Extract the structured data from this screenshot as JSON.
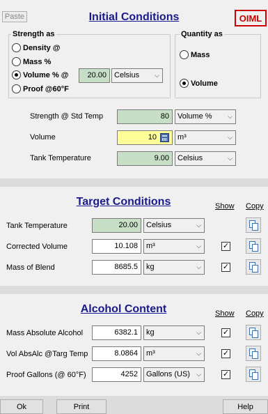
{
  "toolbar": {
    "paste_label": "Paste",
    "oiml_label": "OIML"
  },
  "initial": {
    "title": "Initial Conditions",
    "strength_group": {
      "title": "Strength as",
      "options": [
        {
          "label": "Density  @"
        },
        {
          "label": "Mass %"
        },
        {
          "label": "Volume %  @"
        },
        {
          "label": "Proof @60°F"
        }
      ],
      "selected": 2,
      "temp_value": "20.00",
      "temp_unit": "Celsius"
    },
    "quantity_group": {
      "title": "Quantity as",
      "options": [
        {
          "label": "Mass"
        },
        {
          "label": "Volume"
        }
      ],
      "selected": 1
    },
    "rows": [
      {
        "label": "Strength @ Std Temp",
        "value": "80",
        "unit": "Volume %"
      },
      {
        "label": "Volume",
        "value": "10",
        "unit": "m³"
      },
      {
        "label": "Tank Temperature",
        "value": "9.00",
        "unit": "Celsius"
      }
    ]
  },
  "target": {
    "title": "Target Conditions",
    "show_label": "Show",
    "copy_label": "Copy",
    "rows": [
      {
        "label": "Tank Temperature",
        "value": "20.00",
        "unit": "Celsius",
        "show": null
      },
      {
        "label": "Corrected Volume",
        "value": "10.108",
        "unit": "m³",
        "show": true
      },
      {
        "label": "Mass of Blend",
        "value": "8685.5",
        "unit": "kg",
        "show": true
      }
    ]
  },
  "alcohol": {
    "title": "Alcohol Content",
    "show_label": "Show",
    "copy_label": "Copy",
    "rows": [
      {
        "label": "Mass Absolute Alcohol",
        "value": "6382.1",
        "unit": "kg",
        "show": true
      },
      {
        "label": "Vol AbsAlc @Targ Temp",
        "value": "8.0864",
        "unit": "m³",
        "show": true
      },
      {
        "label": "Proof Gallons (@ 60°F)",
        "value": "4252",
        "unit": "Gallons (US)",
        "show": true
      }
    ]
  },
  "footer": {
    "ok_label": "Ok",
    "print_label": "Print",
    "help_label": "Help"
  }
}
